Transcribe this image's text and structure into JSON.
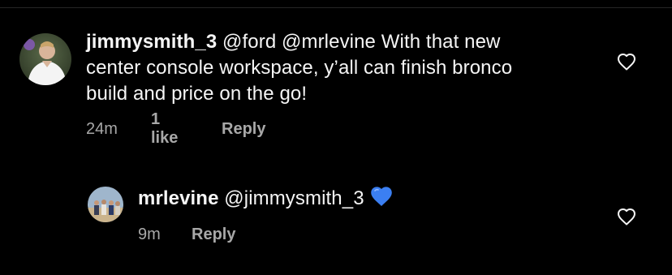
{
  "comments": [
    {
      "username": "jimmysmith_3",
      "text": " @ford @mrlevine With that new",
      "text_line2": "center console workspace, y’all can finish bronco",
      "text_line3": "build and price on the go!",
      "time": "24m",
      "likes": "1 like",
      "reply_label": "Reply",
      "like_icon": "heart-outline-icon"
    },
    {
      "username": "mrlevine",
      "text": " @jimmysmith_3",
      "emoji": "blue-heart-emoji",
      "time": "9m",
      "reply_label": "Reply",
      "like_icon": "heart-outline-icon"
    }
  ],
  "colors": {
    "background": "#000000",
    "primary_text": "#f5f5f5",
    "secondary_text": "#a8a8a8",
    "blue_heart": "#3b7ff2"
  }
}
